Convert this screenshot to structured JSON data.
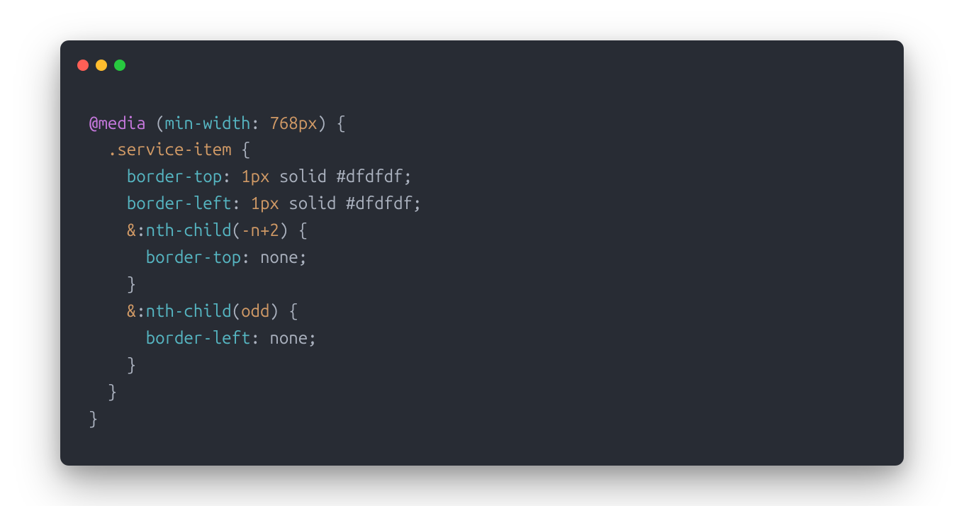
{
  "window": {
    "traffic_lights": [
      "close",
      "minimize",
      "maximize"
    ]
  },
  "code": {
    "line1": {
      "at": "@media",
      "paren_open": " (",
      "prop": "min-width",
      "colon": ":",
      "space": " ",
      "val": "768px",
      "paren_close": ")",
      "brace": " {"
    },
    "line2": {
      "indent": "  ",
      "sel": ".service-item",
      "brace": " {"
    },
    "line3": {
      "indent": "    ",
      "prop": "border-top",
      "colon": ":",
      "space": " ",
      "num": "1px",
      "rest": " solid #dfdfdf",
      "semi": ";"
    },
    "line4": {
      "indent": "    ",
      "prop": "border-left",
      "colon": ":",
      "space": " ",
      "num": "1px",
      "rest": " solid #dfdfdf",
      "semi": ";"
    },
    "line5": {
      "indent": "    ",
      "amp": "&",
      "colon": ":",
      "pseudo": "nth-child",
      "paren_open": "(",
      "arg": "-n+2",
      "paren_close": ")",
      "brace": " {"
    },
    "line6": {
      "indent": "      ",
      "prop": "border-top",
      "colon": ":",
      "space": " ",
      "val": "none",
      "semi": ";"
    },
    "line7": {
      "indent": "    ",
      "brace": "}"
    },
    "line8": {
      "indent": "    ",
      "amp": "&",
      "colon": ":",
      "pseudo": "nth-child",
      "paren_open": "(",
      "arg": "odd",
      "paren_close": ")",
      "brace": " {"
    },
    "line9": {
      "indent": "      ",
      "prop": "border-left",
      "colon": ":",
      "space": " ",
      "val": "none",
      "semi": ";"
    },
    "line10": {
      "indent": "    ",
      "brace": "}"
    },
    "line11": {
      "indent": "  ",
      "brace": "}"
    },
    "line12": {
      "brace": "}"
    }
  }
}
